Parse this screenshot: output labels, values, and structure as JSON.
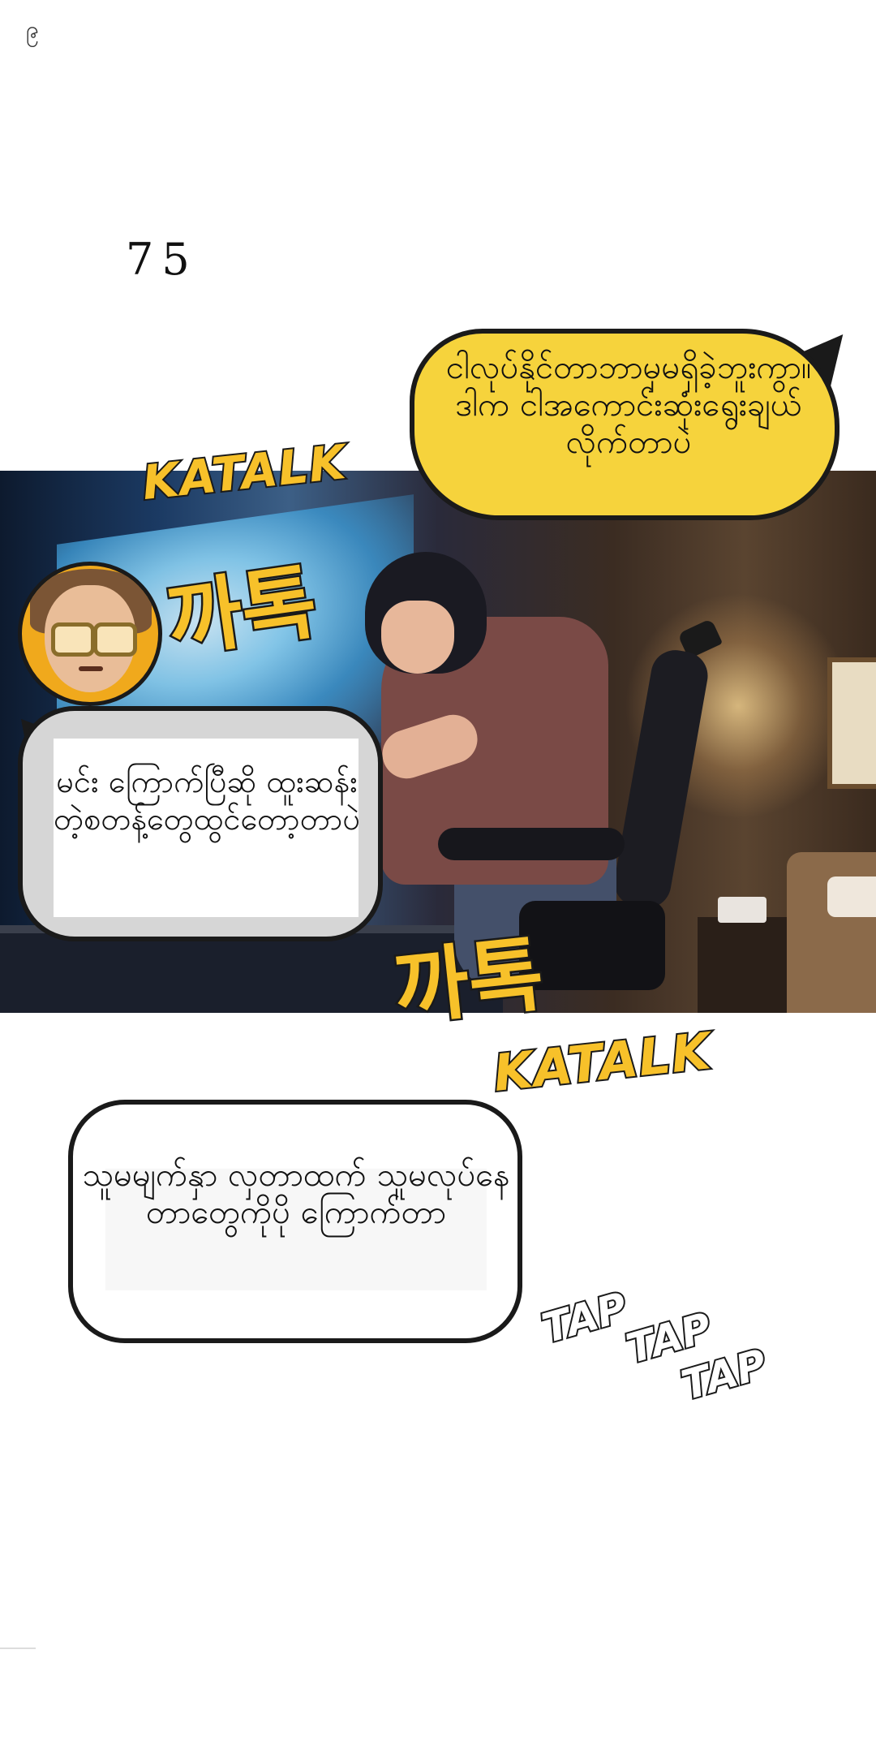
{
  "page": {
    "corner_mark": "၉",
    "page_number": "75"
  },
  "panel": {
    "avatar_label": "avatar"
  },
  "bubbles": {
    "top_yellow": "ငါလုပ်နိုင်တာဘာမှမရှိခဲ့ဘူးကွာ။ဒါက ငါအကောင်းဆုံးရွေးချယ်လိုက်တာပဲ",
    "left_white": "မင်း ကြောက်ပြီဆို ထူးဆန်းတဲ့စတန့်တွေထွင်တော့တာပဲ",
    "bottom_white": "သူမမျက်နှာ လှတာထက် သူမလုပ်နေတာတွေကိုပို ကြောက်တာ"
  },
  "sfx": {
    "katalk_top": "KATALK",
    "kkatok_top": "까톡",
    "kkatok_bottom": "까톡",
    "katalk_bottom": "KATALK",
    "tap1": "TAP",
    "tap2": "TAP",
    "tap3": "TAP"
  },
  "colors": {
    "bubble_yellow": "#f6d33c",
    "sfx_yellow": "#f7c12a",
    "outline": "#1a1a1a"
  }
}
